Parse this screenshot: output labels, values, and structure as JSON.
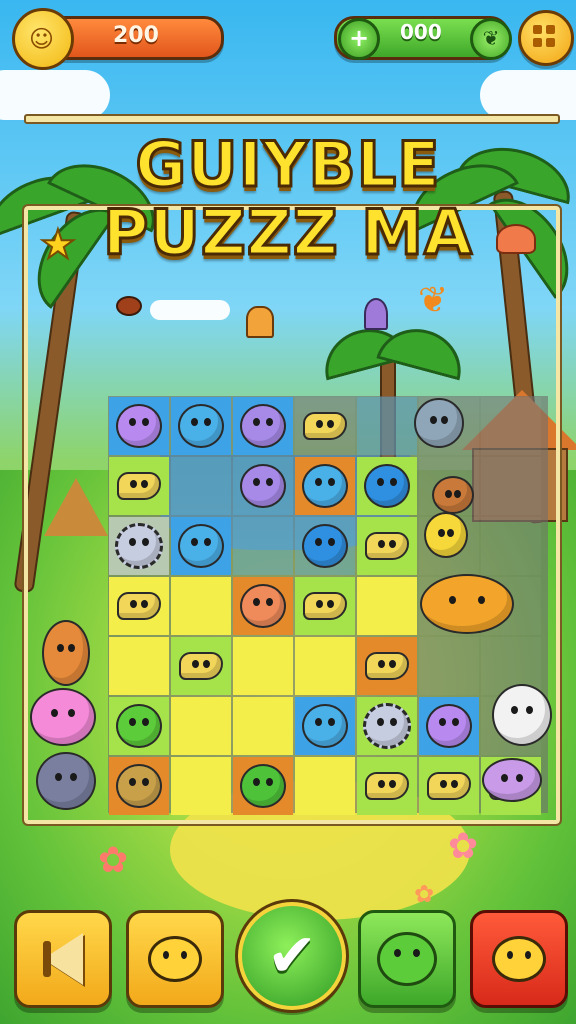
{
  "hud": {
    "coins": "200",
    "gems": "000",
    "gem_plus_glyph": "+",
    "gem_leaf_glyph": "❦",
    "coin_face_glyph": "☺"
  },
  "title": {
    "line1": "GUIYBLE",
    "line2": "PUZZZ MA"
  },
  "decor": {
    "star_glyph": "★",
    "butterfly_glyph": "❦",
    "flower_glyph": "✿"
  },
  "colors": {
    "tile_yellow": "#f4ee4b",
    "tile_lime": "#a6e34a",
    "tile_blue": "#3ea3e6",
    "tile_orange": "#e48a2a",
    "coin_pill": "#e2561c",
    "gem_pill": "#3fa82a"
  },
  "grid": {
    "rows": 7,
    "cols": 7,
    "tiles": [
      [
        "blue:bird",
        "blue:cat",
        "blue:seahorse",
        "empty:snake",
        "sea:",
        "empty:",
        "empty:"
      ],
      [
        "lime:snake",
        "sea:",
        "sea:seahorse",
        "orange:cat",
        "lime:ball",
        "empty:",
        "empty:"
      ],
      [
        "grey:spiky",
        "blue:cat",
        "sea:",
        "sea:ball",
        "lime:snake",
        "empty:",
        "empty:"
      ],
      [
        "yellow:snake",
        "yellow:",
        "orange:squirrel",
        "lime:snake",
        "yellow:",
        "empty:",
        "empty:"
      ],
      [
        "yellow:",
        "lime:snake",
        "yellow:",
        "yellow:",
        "orange:snake",
        "empty:",
        "empty:"
      ],
      [
        "lime:flower",
        "yellow:",
        "yellow:",
        "blue:cat",
        "lime:spiky",
        "blue:bird",
        "empty:"
      ],
      [
        "orange:bug",
        "yellow:",
        "orange:frog",
        "yellow:",
        "lime:snake",
        "lime:snake",
        "lime:snake"
      ]
    ]
  },
  "controls": {
    "back_label": "back-button",
    "hint_label": "hint-button",
    "confirm_glyph": "✔",
    "pet_label": "pet-button",
    "tool_label": "tool-button"
  }
}
